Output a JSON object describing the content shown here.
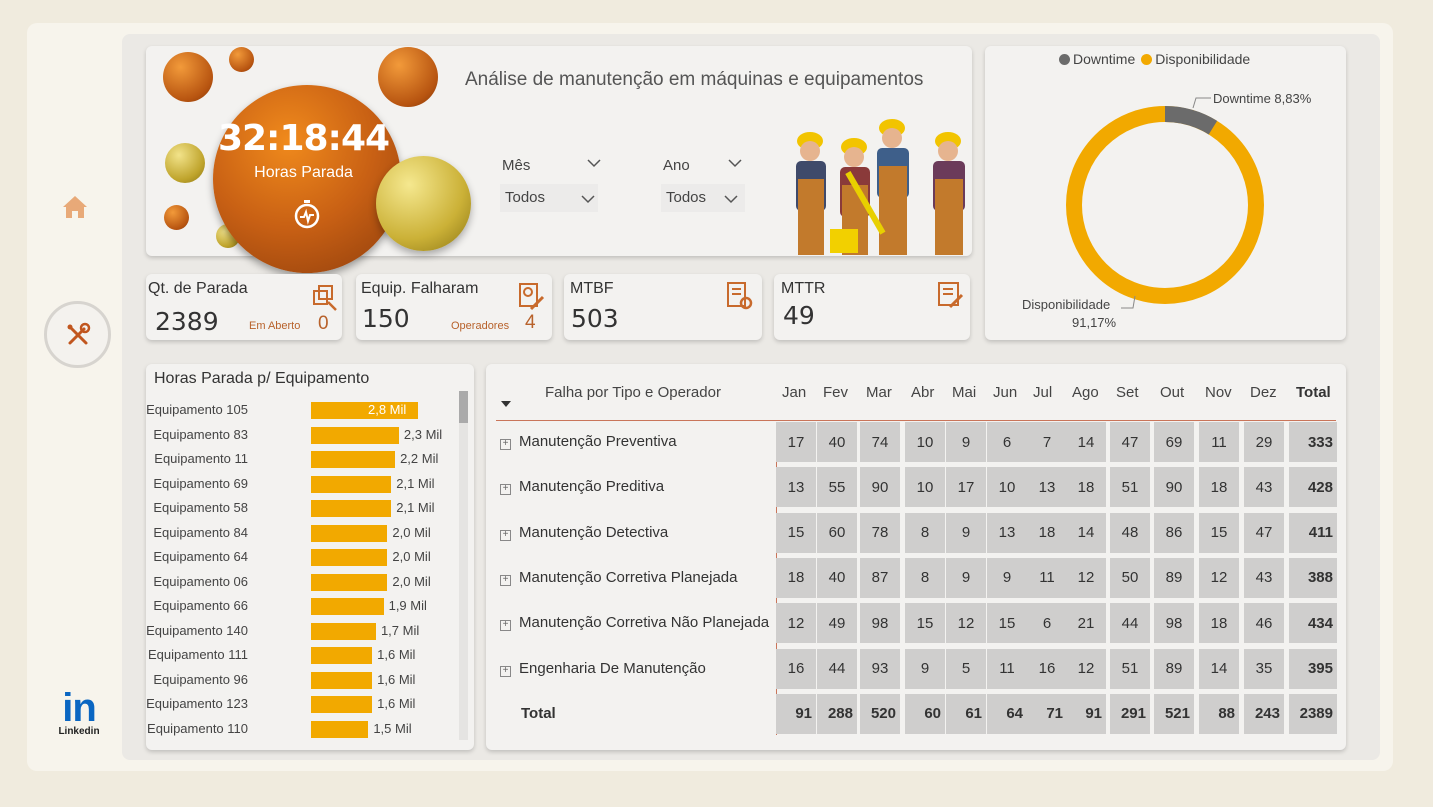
{
  "header": {
    "title": "Análise de manutenção em máquinas e equipamentos",
    "hours_stopped": "32:18:44",
    "hours_label": "Horas Parada",
    "filters": [
      {
        "label": "Mês",
        "value": "Todos"
      },
      {
        "label": "Ano",
        "value": "Todos"
      }
    ]
  },
  "colors": {
    "accent": "#f2a900",
    "downtime": "#6b6b6b",
    "kpi_sub": "#b8622b",
    "icon": "#c86a2c"
  },
  "donut": {
    "legend": [
      {
        "label": "Downtime",
        "color": "#6b6b6b"
      },
      {
        "label": "Disponibilidade",
        "color": "#f2a900"
      }
    ],
    "downtime_label": "Downtime 8,83%",
    "availability_label": "Disponibilidade",
    "availability_value": "91,17%",
    "downtime_pct": 8.83
  },
  "kpis": [
    {
      "title": "Qt. de Parada",
      "value": "2389",
      "sub_label": "Em Aberto",
      "sub_value": "0",
      "icon": "copy-wrench-icon"
    },
    {
      "title": "Equip. Falharam",
      "value": "150",
      "sub_label": "Operadores",
      "sub_value": "4",
      "icon": "doc-gear-pencil-icon"
    },
    {
      "title": "MTBF",
      "value": "503",
      "icon": "report-gear-icon"
    },
    {
      "title": "MTTR",
      "value": "49",
      "icon": "checklist-pencil-icon"
    }
  ],
  "bar_chart": {
    "title": "Horas Parada p/  Equipamento",
    "items": [
      {
        "label": "Equipamento 105",
        "value": 2.8,
        "text": "2,8 Mil"
      },
      {
        "label": "Equipamento 83",
        "value": 2.3,
        "text": "2,3 Mil"
      },
      {
        "label": "Equipamento 11",
        "value": 2.2,
        "text": "2,2 Mil"
      },
      {
        "label": "Equipamento 69",
        "value": 2.1,
        "text": "2,1 Mil"
      },
      {
        "label": "Equipamento 58",
        "value": 2.1,
        "text": "2,1 Mil"
      },
      {
        "label": "Equipamento 84",
        "value": 2.0,
        "text": "2,0 Mil"
      },
      {
        "label": "Equipamento 64",
        "value": 2.0,
        "text": "2,0 Mil"
      },
      {
        "label": "Equipamento 06",
        "value": 2.0,
        "text": "2,0 Mil"
      },
      {
        "label": "Equipamento 66",
        "value": 1.9,
        "text": "1,9 Mil"
      },
      {
        "label": "Equipamento 140",
        "value": 1.7,
        "text": "1,7 Mil"
      },
      {
        "label": "Equipamento 111",
        "value": 1.6,
        "text": "1,6 Mil"
      },
      {
        "label": "Equipamento 96",
        "value": 1.6,
        "text": "1,6 Mil"
      },
      {
        "label": "Equipamento 123",
        "value": 1.6,
        "text": "1,6 Mil"
      },
      {
        "label": "Equipamento 110",
        "value": 1.5,
        "text": "1,5 Mil"
      }
    ]
  },
  "matrix": {
    "row_header": "Falha por Tipo e Operador",
    "columns": [
      "Jan",
      "Fev",
      "Mar",
      "Abr",
      "Mai",
      "Jun",
      "Jul",
      "Ago",
      "Set",
      "Out",
      "Nov",
      "Dez",
      "Total"
    ],
    "rows": [
      {
        "label": "Manutenção Preventiva",
        "values": [
          "17",
          "40",
          "74",
          "10",
          "9",
          "6",
          "7",
          "14",
          "47",
          "69",
          "11",
          "29",
          "333"
        ]
      },
      {
        "label": "Manutenção Preditiva",
        "values": [
          "13",
          "55",
          "90",
          "10",
          "17",
          "10",
          "13",
          "18",
          "51",
          "90",
          "18",
          "43",
          "428"
        ]
      },
      {
        "label": "Manutenção Detectiva",
        "values": [
          "15",
          "60",
          "78",
          "8",
          "9",
          "13",
          "18",
          "14",
          "48",
          "86",
          "15",
          "47",
          "411"
        ]
      },
      {
        "label": "Manutenção Corretiva Planejada",
        "values": [
          "18",
          "40",
          "87",
          "8",
          "9",
          "9",
          "11",
          "12",
          "50",
          "89",
          "12",
          "43",
          "388"
        ]
      },
      {
        "label": "Manutenção Corretiva Não Planejada",
        "values": [
          "12",
          "49",
          "98",
          "15",
          "12",
          "15",
          "6",
          "21",
          "44",
          "98",
          "18",
          "46",
          "434"
        ]
      },
      {
        "label": "Engenharia De Manutenção",
        "values": [
          "16",
          "44",
          "93",
          "9",
          "5",
          "11",
          "16",
          "12",
          "51",
          "89",
          "14",
          "35",
          "395"
        ]
      }
    ],
    "total_row": {
      "label": "Total",
      "values": [
        "91",
        "288",
        "520",
        "60",
        "61",
        "64",
        "71",
        "91",
        "291",
        "521",
        "88",
        "243",
        "2389"
      ]
    }
  },
  "linkedin": {
    "mark": "in",
    "text": "Linkedin"
  }
}
